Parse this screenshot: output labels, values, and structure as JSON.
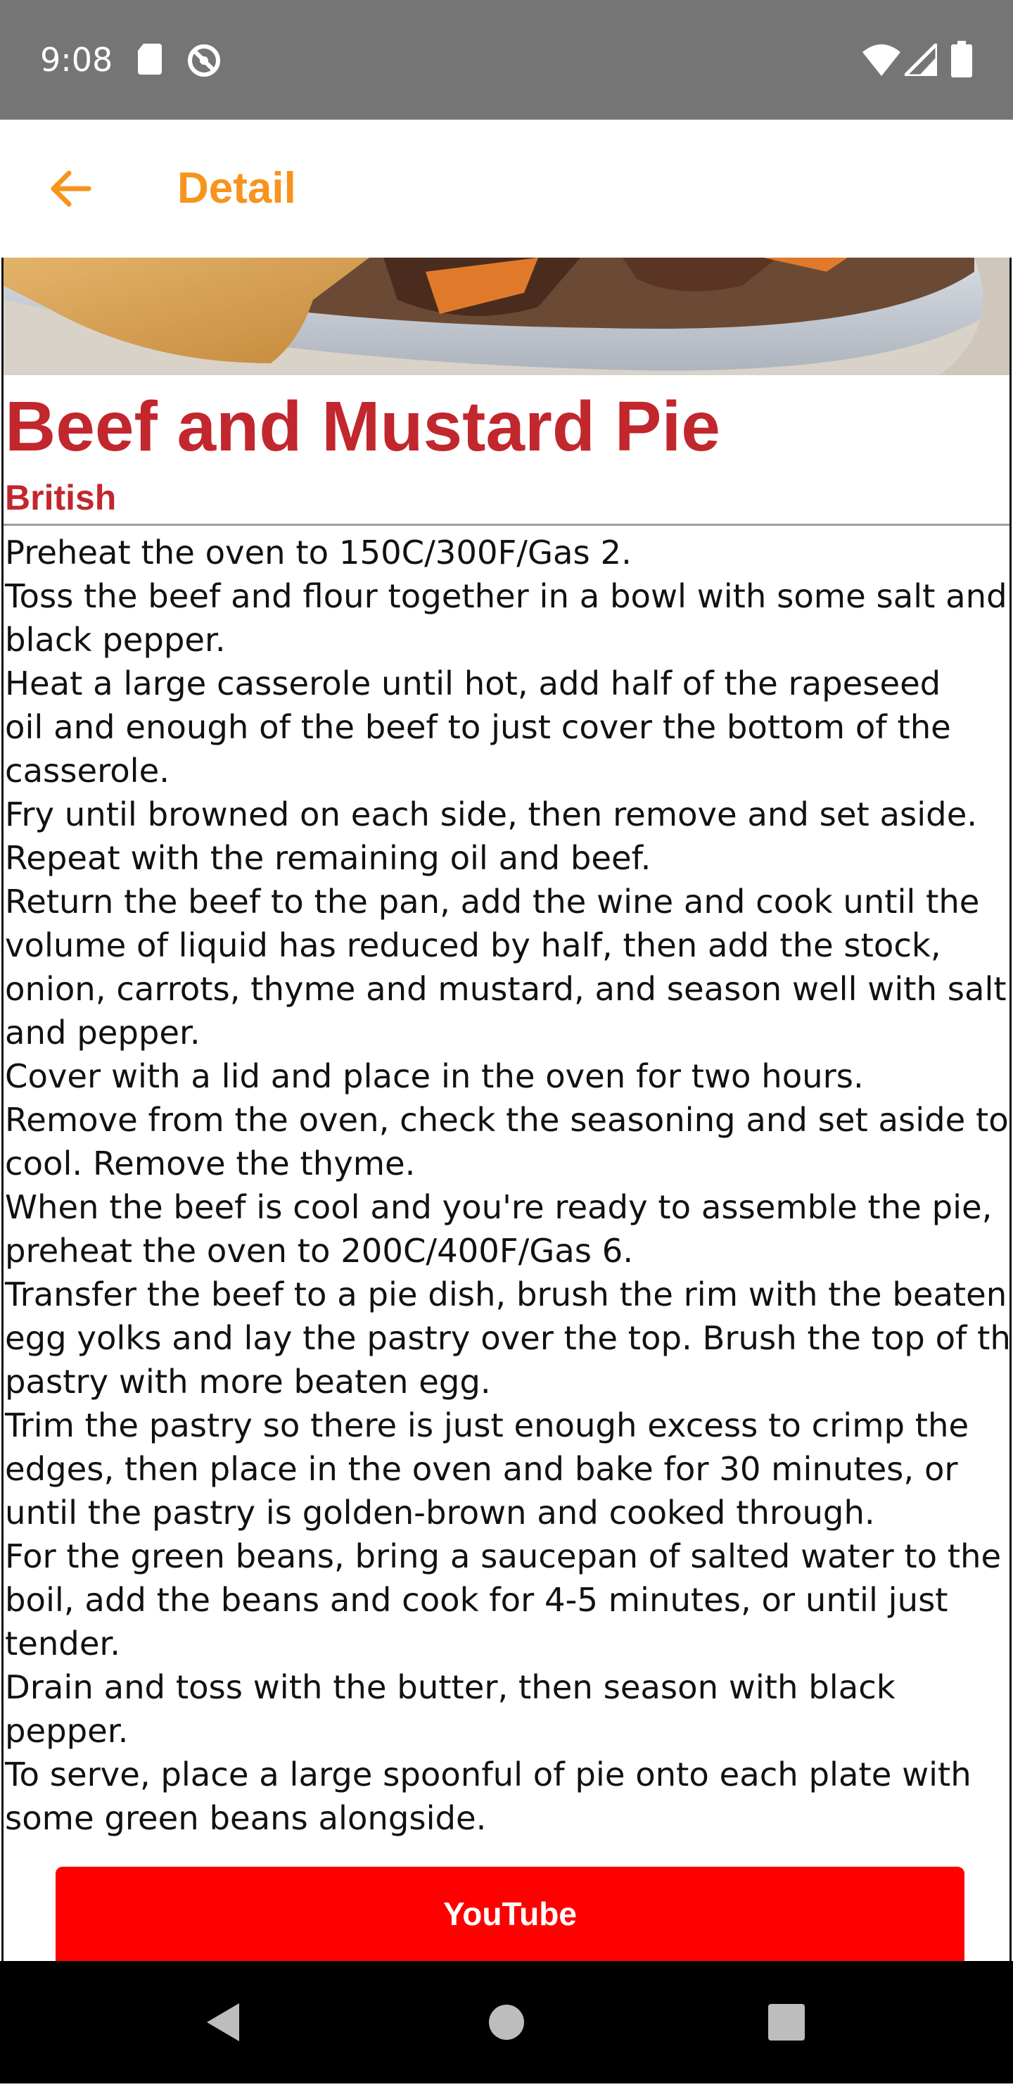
{
  "status_bar": {
    "time": "9:08",
    "icons": [
      "sd-card-icon",
      "sync-icon",
      "wifi-icon",
      "signal-icon",
      "battery-icon"
    ]
  },
  "app_bar": {
    "title": "Detail",
    "back_icon": "arrow-back-icon",
    "accent_color": "#f7941d"
  },
  "meal": {
    "name": "Beef and Mustard Pie",
    "area": "British",
    "title_color": "#c1272d",
    "instruction_lines": [
      "Preheat the oven to 150C/300F/Gas 2.",
      "Toss the beef and flour together in a bowl with some salt and",
      "black pepper.",
      "Heat a large casserole until hot, add half of the rapeseed",
      "oil and enough of the beef to just cover the bottom of the",
      "casserole.",
      "Fry until browned on each side, then remove and set aside.",
      "Repeat with the remaining oil and beef.",
      "Return the beef to the pan, add the wine and cook until the",
      "volume of liquid has reduced by half, then add the stock,",
      "onion, carrots, thyme and mustard, and season well with salt",
      "and pepper.",
      "Cover with a lid and place in the oven for two hours.",
      "Remove from the oven, check the seasoning and set aside to",
      "cool. Remove the thyme.",
      "When the beef is cool and you're ready to assemble the pie,",
      "preheat the oven to 200C/400F/Gas 6.",
      "Transfer the beef to a pie dish, brush the rim with the beaten",
      "egg yolks and lay the pastry over the top. Brush the top of the",
      "pastry with more beaten egg.",
      "Trim the pastry so there is just enough excess to crimp the",
      "edges, then place in the oven and bake for 30 minutes, or",
      "until the pastry is golden-brown and cooked through.",
      "For the green beans, bring a saucepan of salted water to the",
      "boil, add the beans and cook for 4-5 minutes, or until just",
      "tender.",
      "Drain and toss with the butter, then season with black",
      "pepper.",
      "To serve, place a large spoonful of pie onto each plate with",
      "some green beans alongside."
    ]
  },
  "youtube_button": {
    "label": "YouTube",
    "color": "#ff0000"
  },
  "nav_bar": {
    "buttons": [
      "back-triangle-icon",
      "home-circle-icon",
      "recents-square-icon"
    ]
  }
}
